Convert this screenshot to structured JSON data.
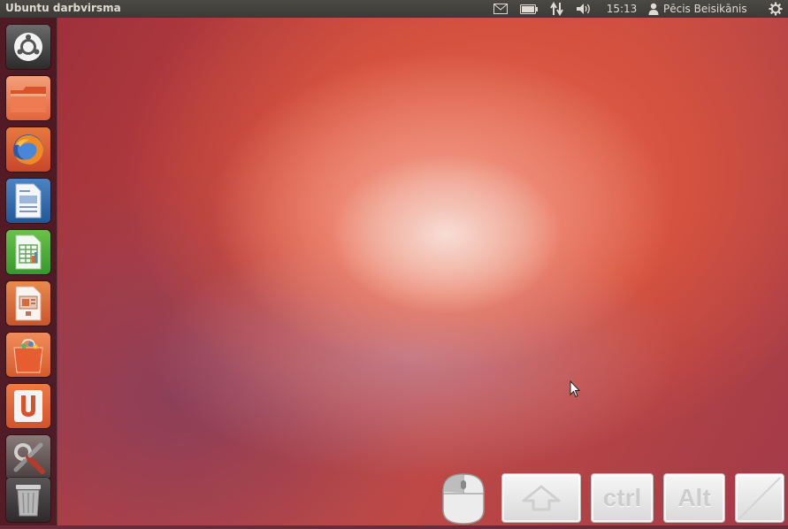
{
  "top_panel": {
    "title": "Ubuntu darbvirsma",
    "clock": "15:13",
    "user_name": "Pēcis Beisikānis",
    "indicators": [
      "mail-icon",
      "battery-icon",
      "network-icon",
      "volume-icon",
      "user-icon",
      "session-gear-icon"
    ]
  },
  "launcher": {
    "items": [
      "dash-home",
      "files",
      "firefox",
      "libreoffice-writer",
      "libreoffice-calc",
      "libreoffice-impress",
      "software-center",
      "ubuntu-one",
      "system-settings",
      "trash"
    ]
  },
  "onscreen_keyboard": {
    "keys": {
      "shift": "⇧",
      "ctrl": "ctrl",
      "alt": "Alt",
      "blank": ""
    }
  },
  "colors": {
    "panel": "#3c3b37",
    "accent": "#dd4814"
  }
}
